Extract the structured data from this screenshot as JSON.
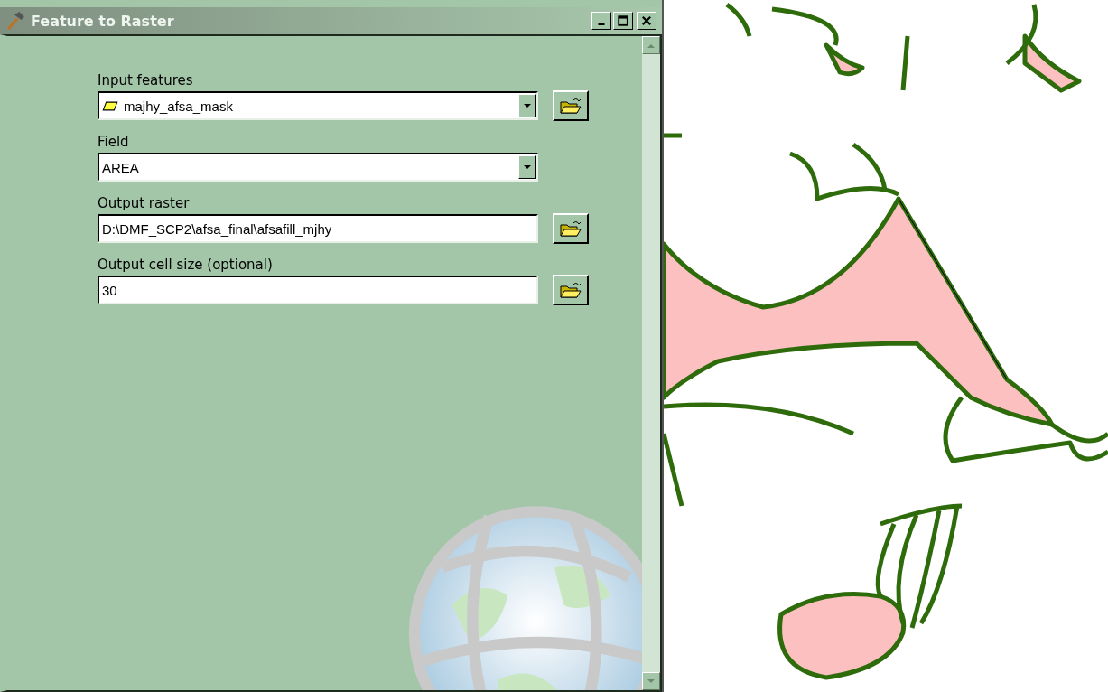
{
  "window": {
    "title": "Feature to Raster"
  },
  "parameters": [
    {
      "label": "Input features",
      "kind": "dropdown",
      "value": "majhy_afsa_mask",
      "layer_icon": true,
      "browse": true
    },
    {
      "label": "Field",
      "kind": "dropdown",
      "value": "AREA",
      "layer_icon": false,
      "browse": false
    },
    {
      "label": "Output raster",
      "kind": "text",
      "value": "D:\\DMF_SCP2\\afsa_final\\afsafill_mjhy",
      "layer_icon": false,
      "browse": true
    },
    {
      "label": "Output cell size (optional)",
      "kind": "text",
      "value": "30",
      "layer_icon": false,
      "browse": true
    }
  ]
}
